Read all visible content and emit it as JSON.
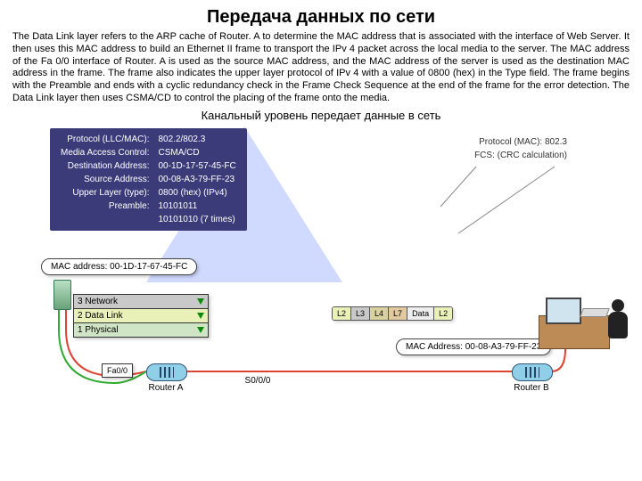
{
  "title": "Передача данных по сети",
  "paragraph": "The Data Link layer refers to the ARP cache of Router. A to determine the MAC address that is associated with the interface of Web Server. It then uses this MAC address to build an Ethernet II frame to transport the IPv 4 packet across the local media to the server. The MAC address of the Fa 0/0 interface of Router. A is used as the source MAC address, and the MAC address of the server is used as the destination MAC address in the frame. The frame also indicates the upper layer protocol of IPv 4 with a value of 0800 (hex) in the Type field. The frame begins with the Preamble and ends with a cyclic redundancy check in the Frame Check Sequence at the end of the frame for the error detection. The Data Link layer then uses CSMA/CD to control the placing of the frame onto the media.",
  "diagram": {
    "subtitle": "Канальный уровень передает данные в сеть",
    "leftPanel": {
      "rows": [
        [
          "Protocol (LLC/MAC):",
          "802.2/802.3"
        ],
        [
          "Media Access Control:",
          "CSMA/CD"
        ],
        [
          "Destination Address:",
          "00-1D-17-57-45-FC"
        ],
        [
          "Source Address:",
          "00-08-A3-79-FF-23"
        ],
        [
          "Upper Layer (type):",
          "0800 (hex) (IPv4)"
        ],
        [
          "Preamble:",
          "10101011"
        ],
        [
          "",
          "10101010 (7 times)"
        ]
      ]
    },
    "rightCallout": {
      "line1": "Protocol (MAC):   802.3",
      "line2": "FCS:   (CRC calculation)"
    },
    "macBoxLeft": "MAC address: 00-1D-17-67-45-FC",
    "macBoxRight": "MAC Address: 00-08-A3-79-FF-23",
    "layers": {
      "l3": "3 Network",
      "l2": "2 Data Link",
      "l1": "1 Physical"
    },
    "pill": {
      "l2": "L2",
      "l3": "L3",
      "l4": "L4",
      "l7": "L7",
      "data": "Data",
      "l2b": "L2"
    },
    "routerA": "Router A",
    "routerB": "Router B",
    "fa": "Fa0/0",
    "s0": "S0/0/0"
  }
}
